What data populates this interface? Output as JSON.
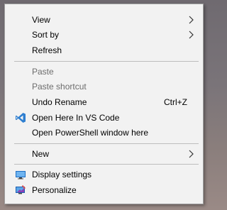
{
  "menu": {
    "view_label": "View",
    "sort_by_label": "Sort by",
    "refresh_label": "Refresh",
    "paste_label": "Paste",
    "paste_shortcut_label": "Paste shortcut",
    "undo_rename_label": "Undo Rename",
    "undo_rename_shortcut": "Ctrl+Z",
    "open_vscode_label": "Open Here In VS Code",
    "open_powershell_label": "Open PowerShell window here",
    "new_label": "New",
    "display_settings_label": "Display settings",
    "personalize_label": "Personalize",
    "icons": {
      "vscode": "vscode-icon",
      "display": "display-settings-icon",
      "personalize": "personalize-icon",
      "submenu": "chevron-right-icon"
    },
    "disabled_color": "#6d6d6d",
    "accent_blue": "#2f7fd0"
  }
}
